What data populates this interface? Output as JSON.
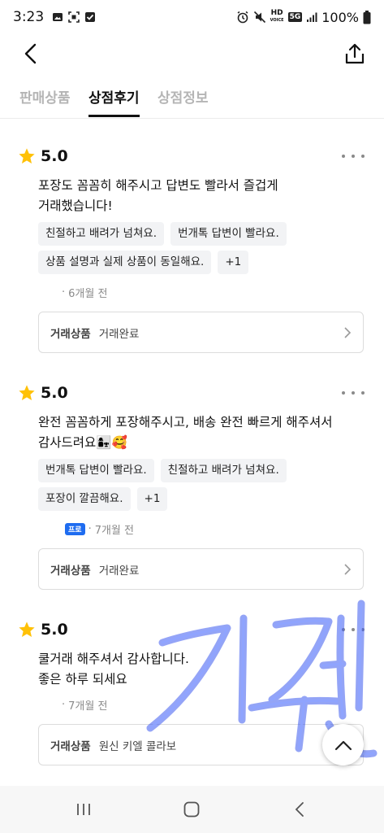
{
  "status_bar": {
    "time": "3:23",
    "left_icons": [
      "image-icon",
      "screenshot-icon",
      "checkbox-icon"
    ],
    "right_icons": [
      "alarm-icon",
      "mute-icon",
      "hd-voice-icon",
      "5g-icon",
      "signal-icon"
    ],
    "hd_text": "HD",
    "net_text": "5G",
    "battery": "100%"
  },
  "header": {
    "back_icon": "chevron-left-icon",
    "share_icon": "share-icon"
  },
  "tabs": [
    {
      "label": "판매상품",
      "active": false
    },
    {
      "label": "상점후기",
      "active": true
    },
    {
      "label": "상점정보",
      "active": false
    }
  ],
  "reviews": [
    {
      "rating": "5.0",
      "text": "포장도 꼼꼼히 해주시고 답변도 빨라서 즐겁게\n거래했습니다!",
      "chips_row1": [
        "친절하고 배려가 넘쳐요.",
        "번개톡 답변이 빨라요."
      ],
      "chips_row2": [
        "상품 설명과 실제 상품이 동일해요.",
        "+1"
      ],
      "time": "6개월 전",
      "trade_label": "거래상품",
      "trade_value": "거래완료"
    },
    {
      "rating": "5.0",
      "text": "완전 꼼꼼하게 포장해주시고, 배송 완전 빠르게 해주셔서\n감사드려요👩‍👧🥰",
      "chips_row1": [
        "번개톡 답변이 빨라요.",
        "친절하고 배려가 넘쳐요."
      ],
      "chips_row2": [
        "포장이 깔끔해요.",
        "+1"
      ],
      "badge": "프로",
      "time": "7개월 전",
      "trade_label": "거래상품",
      "trade_value": "거래완료"
    },
    {
      "rating": "5.0",
      "text": "쿨거래 해주셔서 감사합니다.\n좋은 하루 되세요",
      "time": "7개월 전",
      "trade_label": "거래상품",
      "trade_value": "원신 키엘 콜라보"
    }
  ],
  "scroll_top_icon": "chevron-up-icon",
  "watermark_icon": "handwritten-signature-icon",
  "watermark_text": "김주젠",
  "nav": [
    "recent-apps-icon",
    "home-icon",
    "back-icon"
  ],
  "colors": {
    "star": "#FFC107",
    "pro_badge": "#1E6CF0",
    "watermark": "#3C5AF0"
  }
}
